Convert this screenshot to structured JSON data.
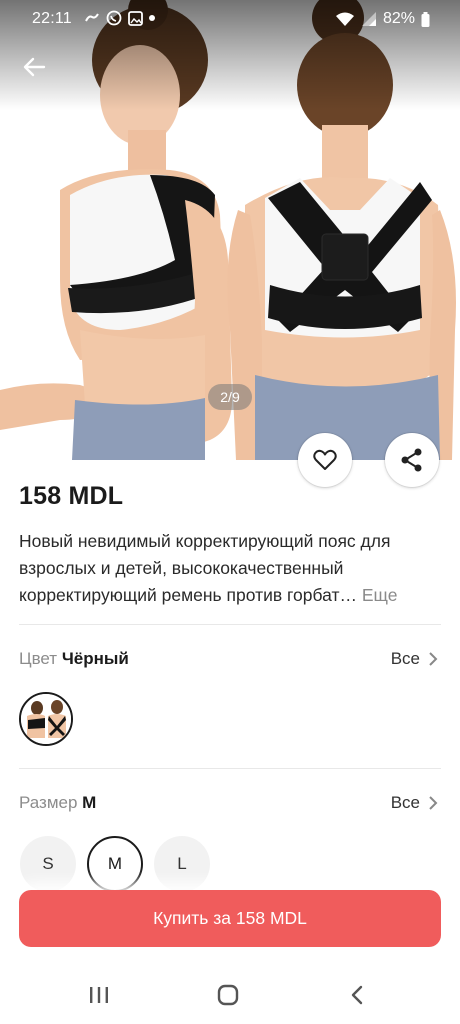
{
  "status_bar": {
    "time": "22:11",
    "battery": "82%"
  },
  "gallery": {
    "counter": "2/9"
  },
  "product": {
    "price": "158 MDL",
    "description": "Новый невидимый корректирующий пояс для взрослых и детей, высококачественный корректирующий ремень против горбат…",
    "more_label": "Еще"
  },
  "color": {
    "label": "Цвет",
    "value": "Чёрный",
    "all_label": "Все"
  },
  "size": {
    "label": "Размер",
    "value": "M",
    "all_label": "Все",
    "options": [
      "S",
      "M",
      "L"
    ],
    "selected": "M"
  },
  "buy_button": {
    "label": "Купить за 158 MDL",
    "color": "#f05c5c"
  },
  "icons": {
    "back": "arrow-left-icon",
    "favorite": "heart-icon",
    "share": "share-icon",
    "chevron": "chevron-right-icon",
    "nav_recents": "recents-icon",
    "nav_home": "home-icon",
    "nav_back": "back-icon"
  }
}
